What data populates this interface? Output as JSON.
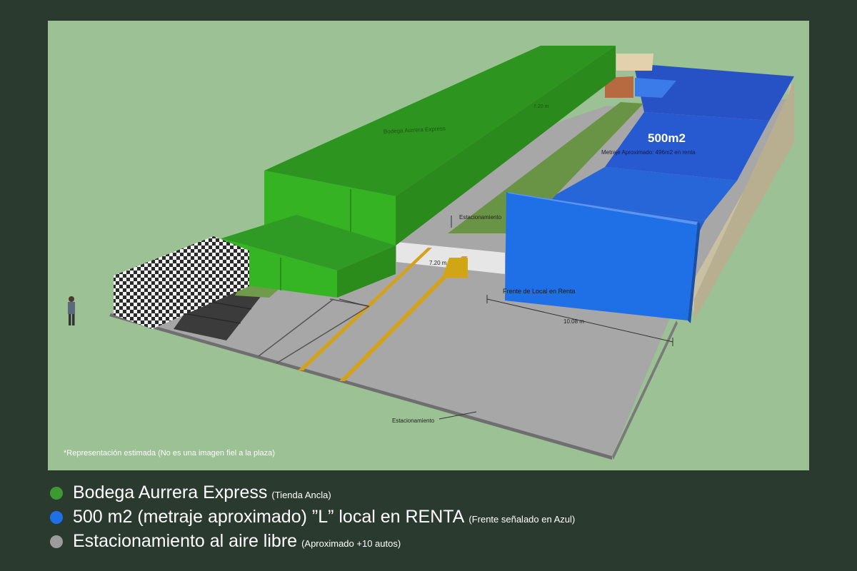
{
  "scene": {
    "labels": {
      "anchor_store_roof": "Bodega Aurrera Express",
      "top_dimension": "7.20 m",
      "big_area": "500m2",
      "big_area_sub": "Metraje Aproximado: 496m2 en renta",
      "parking_top": "Estacionamiento",
      "width_dimension": "7.20 m",
      "front_label": "Frente de Local en Renta",
      "front_dimension": "10.08 m",
      "parking_bottom": "Estacionamiento"
    },
    "disclaimer": "*Representación estimada (No es una imagen fiel a la plaza)"
  },
  "legend": [
    {
      "label": "Bodega Aurrera Express",
      "note": "(Tienda Ancla)",
      "color": "#3d9a33"
    },
    {
      "label": "500 m2 (metraje aproximado) ”L” local en RENTA",
      "note": "(Frente señalado en Azul)",
      "color": "#1f6fe6"
    },
    {
      "label": "Estacionamiento al aire libre",
      "note": "(Aproximado +10 autos)",
      "color": "#9c9c9c"
    }
  ],
  "colors": {
    "panel_bg": "#9bc194",
    "page_bg": "#2b3a2f",
    "anchor_green": "#2f9b25",
    "rental_blue": "#2a64d6",
    "parking_gray": "#a9a9a9"
  }
}
